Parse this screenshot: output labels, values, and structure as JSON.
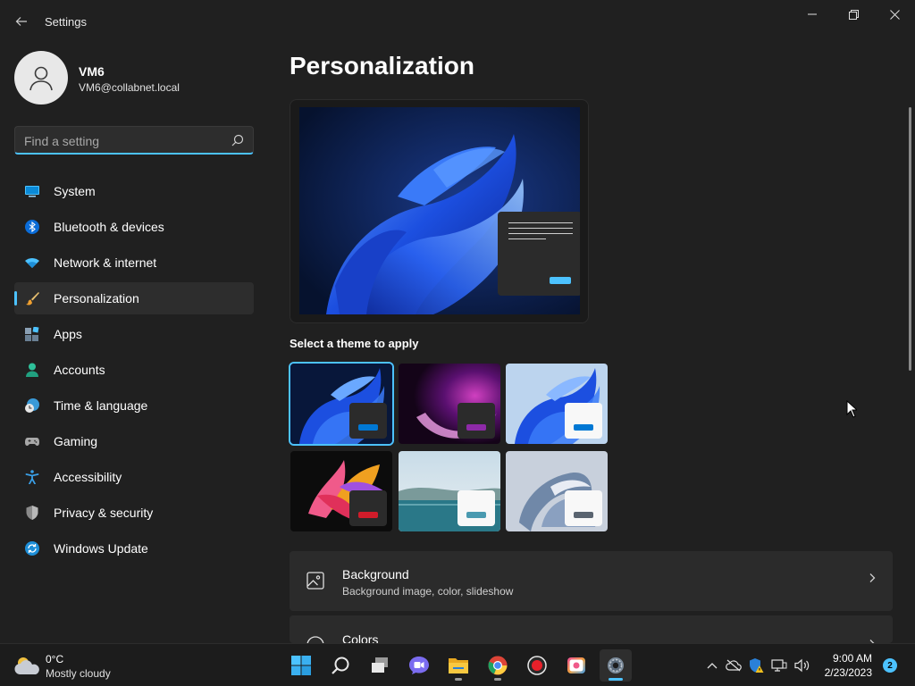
{
  "window": {
    "app_title": "Settings",
    "back_icon": "back-arrow-icon",
    "minimize_icon": "minimize-icon",
    "restore_icon": "restore-icon",
    "close_icon": "close-icon"
  },
  "user": {
    "name": "VM6",
    "email": "VM6@collabnet.local",
    "avatar_icon": "person-icon"
  },
  "search": {
    "placeholder": "Find a setting",
    "value": "",
    "icon": "search-icon"
  },
  "sidebar": {
    "items": [
      {
        "label": "System",
        "icon": "system-display-icon",
        "active": false
      },
      {
        "label": "Bluetooth & devices",
        "icon": "bluetooth-icon",
        "active": false
      },
      {
        "label": "Network & internet",
        "icon": "wifi-icon",
        "active": false
      },
      {
        "label": "Personalization",
        "icon": "paintbrush-icon",
        "active": true
      },
      {
        "label": "Apps",
        "icon": "apps-icon",
        "active": false
      },
      {
        "label": "Accounts",
        "icon": "account-icon",
        "active": false
      },
      {
        "label": "Time & language",
        "icon": "clock-globe-icon",
        "active": false
      },
      {
        "label": "Gaming",
        "icon": "gamepad-icon",
        "active": false
      },
      {
        "label": "Accessibility",
        "icon": "accessibility-icon",
        "active": false
      },
      {
        "label": "Privacy & security",
        "icon": "shield-icon",
        "active": false
      },
      {
        "label": "Windows Update",
        "icon": "update-icon",
        "active": false
      }
    ]
  },
  "main": {
    "title": "Personalization",
    "theme_section_label": "Select a theme to apply",
    "themes": [
      {
        "name": "dark-bloom",
        "selected": true,
        "accent": "#0078d4"
      },
      {
        "name": "glow",
        "selected": false,
        "accent": "#8e2aa8"
      },
      {
        "name": "light-bloom",
        "selected": false,
        "accent": "#0078d4"
      },
      {
        "name": "captured-motion",
        "selected": false,
        "accent": "#d01c2a"
      },
      {
        "name": "sunrise",
        "selected": false,
        "accent": "#4a9ab0"
      },
      {
        "name": "flow",
        "selected": false,
        "accent": "#5a6470"
      }
    ],
    "cards": [
      {
        "title": "Background",
        "subtitle": "Background image, color, slideshow",
        "icon": "image-icon"
      },
      {
        "title": "Colors",
        "subtitle": "",
        "icon": "palette-icon"
      }
    ]
  },
  "taskbar": {
    "weather": {
      "temp": "0°C",
      "condition": "Mostly cloudy",
      "icon": "cloud-sun-icon"
    },
    "apps": [
      {
        "name": "start-icon"
      },
      {
        "name": "search-icon"
      },
      {
        "name": "task-view-icon"
      },
      {
        "name": "teams-chat-icon"
      },
      {
        "name": "file-explorer-icon"
      },
      {
        "name": "chrome-icon"
      },
      {
        "name": "record-icon"
      },
      {
        "name": "photos-icon"
      },
      {
        "name": "settings-gear-icon"
      }
    ],
    "tray": {
      "chevron_icon": "chevron-up-icon",
      "onedrive_icon": "onedrive-icon",
      "defender_icon": "security-warning-icon",
      "network_icon": "network-icon",
      "volume_icon": "volume-icon"
    },
    "time": "9:00 AM",
    "date": "2/23/2023",
    "notifications": "2"
  },
  "colors": {
    "accent": "#4cc2ff",
    "background": "#202020",
    "card": "#2b2b2b"
  }
}
